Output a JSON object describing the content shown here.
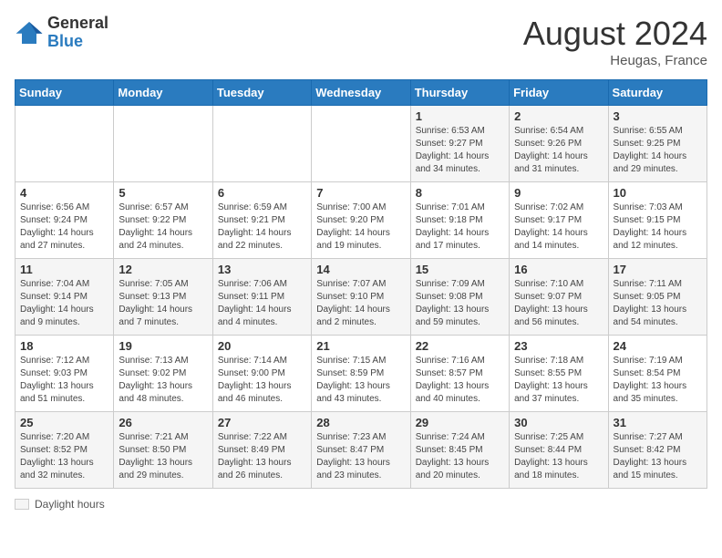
{
  "header": {
    "logo_general": "General",
    "logo_blue": "Blue",
    "month_year": "August 2024",
    "location": "Heugas, France"
  },
  "legend": {
    "label": "Daylight hours"
  },
  "days_of_week": [
    "Sunday",
    "Monday",
    "Tuesday",
    "Wednesday",
    "Thursday",
    "Friday",
    "Saturday"
  ],
  "weeks": [
    [
      {
        "day": "",
        "sunrise": "",
        "sunset": "",
        "daylight": ""
      },
      {
        "day": "",
        "sunrise": "",
        "sunset": "",
        "daylight": ""
      },
      {
        "day": "",
        "sunrise": "",
        "sunset": "",
        "daylight": ""
      },
      {
        "day": "",
        "sunrise": "",
        "sunset": "",
        "daylight": ""
      },
      {
        "day": "1",
        "sunrise": "Sunrise: 6:53 AM",
        "sunset": "Sunset: 9:27 PM",
        "daylight": "Daylight: 14 hours and 34 minutes."
      },
      {
        "day": "2",
        "sunrise": "Sunrise: 6:54 AM",
        "sunset": "Sunset: 9:26 PM",
        "daylight": "Daylight: 14 hours and 31 minutes."
      },
      {
        "day": "3",
        "sunrise": "Sunrise: 6:55 AM",
        "sunset": "Sunset: 9:25 PM",
        "daylight": "Daylight: 14 hours and 29 minutes."
      }
    ],
    [
      {
        "day": "4",
        "sunrise": "Sunrise: 6:56 AM",
        "sunset": "Sunset: 9:24 PM",
        "daylight": "Daylight: 14 hours and 27 minutes."
      },
      {
        "day": "5",
        "sunrise": "Sunrise: 6:57 AM",
        "sunset": "Sunset: 9:22 PM",
        "daylight": "Daylight: 14 hours and 24 minutes."
      },
      {
        "day": "6",
        "sunrise": "Sunrise: 6:59 AM",
        "sunset": "Sunset: 9:21 PM",
        "daylight": "Daylight: 14 hours and 22 minutes."
      },
      {
        "day": "7",
        "sunrise": "Sunrise: 7:00 AM",
        "sunset": "Sunset: 9:20 PM",
        "daylight": "Daylight: 14 hours and 19 minutes."
      },
      {
        "day": "8",
        "sunrise": "Sunrise: 7:01 AM",
        "sunset": "Sunset: 9:18 PM",
        "daylight": "Daylight: 14 hours and 17 minutes."
      },
      {
        "day": "9",
        "sunrise": "Sunrise: 7:02 AM",
        "sunset": "Sunset: 9:17 PM",
        "daylight": "Daylight: 14 hours and 14 minutes."
      },
      {
        "day": "10",
        "sunrise": "Sunrise: 7:03 AM",
        "sunset": "Sunset: 9:15 PM",
        "daylight": "Daylight: 14 hours and 12 minutes."
      }
    ],
    [
      {
        "day": "11",
        "sunrise": "Sunrise: 7:04 AM",
        "sunset": "Sunset: 9:14 PM",
        "daylight": "Daylight: 14 hours and 9 minutes."
      },
      {
        "day": "12",
        "sunrise": "Sunrise: 7:05 AM",
        "sunset": "Sunset: 9:13 PM",
        "daylight": "Daylight: 14 hours and 7 minutes."
      },
      {
        "day": "13",
        "sunrise": "Sunrise: 7:06 AM",
        "sunset": "Sunset: 9:11 PM",
        "daylight": "Daylight: 14 hours and 4 minutes."
      },
      {
        "day": "14",
        "sunrise": "Sunrise: 7:07 AM",
        "sunset": "Sunset: 9:10 PM",
        "daylight": "Daylight: 14 hours and 2 minutes."
      },
      {
        "day": "15",
        "sunrise": "Sunrise: 7:09 AM",
        "sunset": "Sunset: 9:08 PM",
        "daylight": "Daylight: 13 hours and 59 minutes."
      },
      {
        "day": "16",
        "sunrise": "Sunrise: 7:10 AM",
        "sunset": "Sunset: 9:07 PM",
        "daylight": "Daylight: 13 hours and 56 minutes."
      },
      {
        "day": "17",
        "sunrise": "Sunrise: 7:11 AM",
        "sunset": "Sunset: 9:05 PM",
        "daylight": "Daylight: 13 hours and 54 minutes."
      }
    ],
    [
      {
        "day": "18",
        "sunrise": "Sunrise: 7:12 AM",
        "sunset": "Sunset: 9:03 PM",
        "daylight": "Daylight: 13 hours and 51 minutes."
      },
      {
        "day": "19",
        "sunrise": "Sunrise: 7:13 AM",
        "sunset": "Sunset: 9:02 PM",
        "daylight": "Daylight: 13 hours and 48 minutes."
      },
      {
        "day": "20",
        "sunrise": "Sunrise: 7:14 AM",
        "sunset": "Sunset: 9:00 PM",
        "daylight": "Daylight: 13 hours and 46 minutes."
      },
      {
        "day": "21",
        "sunrise": "Sunrise: 7:15 AM",
        "sunset": "Sunset: 8:59 PM",
        "daylight": "Daylight: 13 hours and 43 minutes."
      },
      {
        "day": "22",
        "sunrise": "Sunrise: 7:16 AM",
        "sunset": "Sunset: 8:57 PM",
        "daylight": "Daylight: 13 hours and 40 minutes."
      },
      {
        "day": "23",
        "sunrise": "Sunrise: 7:18 AM",
        "sunset": "Sunset: 8:55 PM",
        "daylight": "Daylight: 13 hours and 37 minutes."
      },
      {
        "day": "24",
        "sunrise": "Sunrise: 7:19 AM",
        "sunset": "Sunset: 8:54 PM",
        "daylight": "Daylight: 13 hours and 35 minutes."
      }
    ],
    [
      {
        "day": "25",
        "sunrise": "Sunrise: 7:20 AM",
        "sunset": "Sunset: 8:52 PM",
        "daylight": "Daylight: 13 hours and 32 minutes."
      },
      {
        "day": "26",
        "sunrise": "Sunrise: 7:21 AM",
        "sunset": "Sunset: 8:50 PM",
        "daylight": "Daylight: 13 hours and 29 minutes."
      },
      {
        "day": "27",
        "sunrise": "Sunrise: 7:22 AM",
        "sunset": "Sunset: 8:49 PM",
        "daylight": "Daylight: 13 hours and 26 minutes."
      },
      {
        "day": "28",
        "sunrise": "Sunrise: 7:23 AM",
        "sunset": "Sunset: 8:47 PM",
        "daylight": "Daylight: 13 hours and 23 minutes."
      },
      {
        "day": "29",
        "sunrise": "Sunrise: 7:24 AM",
        "sunset": "Sunset: 8:45 PM",
        "daylight": "Daylight: 13 hours and 20 minutes."
      },
      {
        "day": "30",
        "sunrise": "Sunrise: 7:25 AM",
        "sunset": "Sunset: 8:44 PM",
        "daylight": "Daylight: 13 hours and 18 minutes."
      },
      {
        "day": "31",
        "sunrise": "Sunrise: 7:27 AM",
        "sunset": "Sunset: 8:42 PM",
        "daylight": "Daylight: 13 hours and 15 minutes."
      }
    ]
  ]
}
